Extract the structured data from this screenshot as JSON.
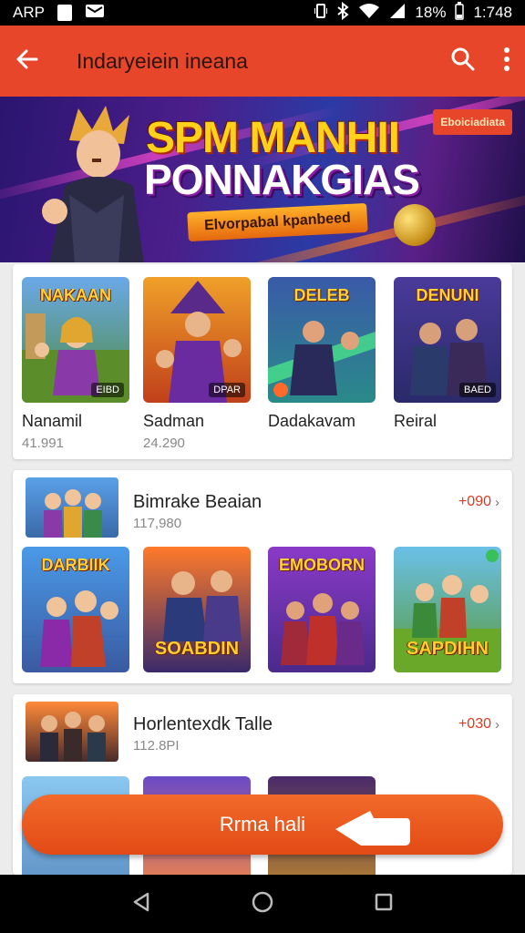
{
  "status_bar": {
    "left_text": "ARP",
    "battery": "18%",
    "time": "1:748"
  },
  "app_bar": {
    "title": "Indaryeiein ineana",
    "icons": [
      "back-arrow-icon",
      "search-icon",
      "more-vert-icon"
    ]
  },
  "banner": {
    "title_line1": "SPM MANHII",
    "title_line2": "PONNAKGIAS",
    "ribbon": "Elvorpabal kpanbeed",
    "tag": "Eboiciadiata"
  },
  "featured_games": [
    {
      "tile_title": "NAKAAN",
      "badge": "EIBD",
      "name": "Nanamil",
      "meta": "41.991"
    },
    {
      "tile_title": "",
      "badge": "DPAR",
      "name": "Sadman",
      "meta": "24.290"
    },
    {
      "tile_title": "DELEB",
      "badge": "",
      "name": "Dadakavam",
      "meta": ""
    },
    {
      "tile_title": "DENUNI",
      "badge": "BAED",
      "name": "Reiral",
      "meta": ""
    }
  ],
  "section1": {
    "title": "Bimrake Beaian",
    "meta": "117,980",
    "price": "+090",
    "tiles": [
      {
        "title": "DARBIIK",
        "bottom": ""
      },
      {
        "title": "",
        "bottom": "SOABDIN"
      },
      {
        "title": "EMOBORN",
        "bottom": ""
      },
      {
        "title": "",
        "bottom": "SAPDIHN"
      }
    ]
  },
  "section2": {
    "title": "Horlentexdk Talle",
    "meta": "112.8PI",
    "price": "+030"
  },
  "cta": {
    "label": "Rrma hali"
  },
  "colors": {
    "primary": "#e8462a",
    "accent_price": "#d93a20",
    "cta": "#e24a15"
  }
}
